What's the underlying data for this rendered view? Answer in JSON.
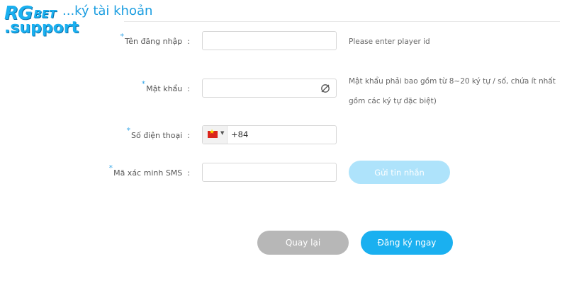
{
  "logo": {
    "rg": "RG",
    "bet": "BET",
    "support": ".support"
  },
  "page_title": "...ký tài khoản",
  "form": {
    "username": {
      "label": "Tên đăng nhập",
      "colon": ":",
      "value": "",
      "hint": "Please enter player id"
    },
    "password": {
      "label": "Mật khẩu",
      "colon": ":",
      "value": "",
      "hint_line1": "Mật khẩu phải bao gồm từ 8~20 ký tự / số, chứa ít nhất",
      "hint_line2": "gồm các ký tự đặc biệt)",
      "icon": "eye-off-icon"
    },
    "phone": {
      "label": "Số điện thoại",
      "colon": ":",
      "country_code": "+84",
      "flag": "vietnam-flag-icon",
      "value": ""
    },
    "sms": {
      "label": "Mã xác minh SMS",
      "colon": ":",
      "value": "",
      "send_button": "Gửi tin nhắn"
    }
  },
  "actions": {
    "back": "Quay lại",
    "register": "Đăng ký ngay"
  },
  "colors": {
    "accent": "#1ab0f0",
    "disabled_accent": "#aee3fb",
    "secondary": "#b7b7b7",
    "required_star": "#3aa8e8"
  }
}
